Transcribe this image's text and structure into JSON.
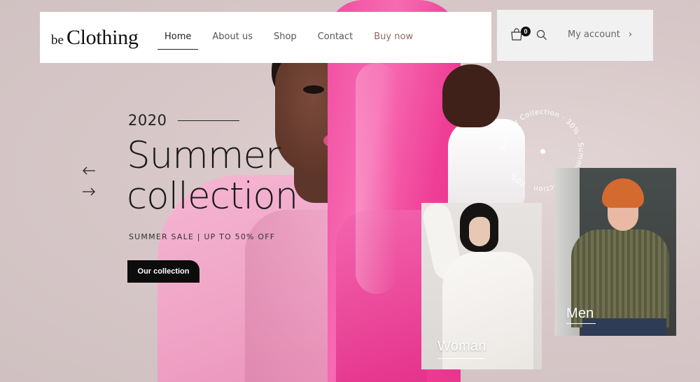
{
  "brand": {
    "prefix": "be",
    "name": "Clothing"
  },
  "nav": {
    "items": [
      {
        "label": "Home",
        "active": true
      },
      {
        "label": "About us",
        "active": false
      },
      {
        "label": "Shop",
        "active": false
      },
      {
        "label": "Contact",
        "active": false
      },
      {
        "label": "Buy now",
        "active": false
      }
    ]
  },
  "header_tools": {
    "cart_icon": "shopping-bag-icon",
    "cart_count": "0",
    "search_icon": "search-icon",
    "account_label": "My account",
    "account_chevron": "›"
  },
  "hero": {
    "year": "2020",
    "headline_line1": "Summer",
    "headline_line2": "collection",
    "sale_text": "SUMMER SALE | UP TO 50% OFF",
    "cta_label": "Our collection",
    "prev_icon": "arrow-left-icon",
    "next_icon": "arrow-right-icon"
  },
  "badge": {
    "ring_text": "Summer Collection · 30% · Summer Collection · 30% ·"
  },
  "categories": [
    {
      "label": "Woman"
    },
    {
      "label": "Men"
    }
  ],
  "colors": {
    "accent_buy": "#8e6b5e",
    "cta_bg": "#0c0c0c",
    "hero_bg": "#d9cbcb",
    "pink": "#f04da0"
  }
}
